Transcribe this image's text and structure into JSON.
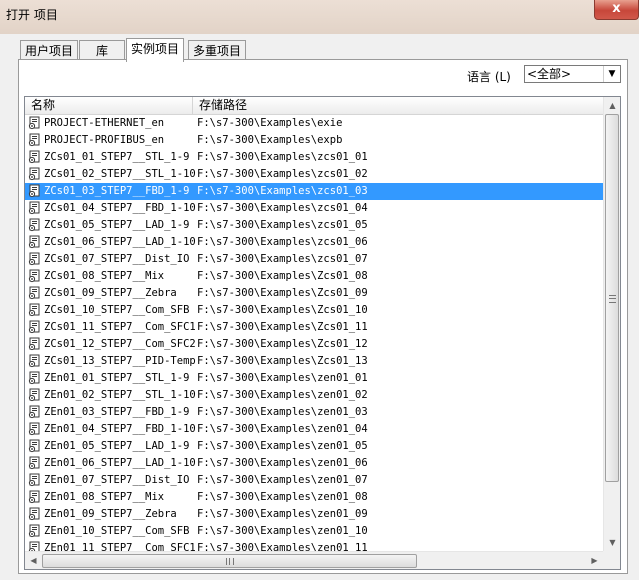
{
  "window": {
    "title": "打开 项目",
    "close_label": "x"
  },
  "tabs": [
    {
      "label": "用户项目"
    },
    {
      "label": "库"
    },
    {
      "label": "实例项目"
    },
    {
      "label": "多重项目"
    }
  ],
  "language": {
    "label": "语言 (L)",
    "selected": "<全部>"
  },
  "columns": {
    "name": "名称",
    "path": "存储路径"
  },
  "projects": [
    {
      "name": "PROJECT-ETHERNET_en",
      "path": "F:\\s7-300\\Examples\\exie"
    },
    {
      "name": "PROJECT-PROFIBUS_en",
      "path": "F:\\s7-300\\Examples\\expb"
    },
    {
      "name": "ZCs01_01_STEP7__STL_1-9",
      "path": "F:\\s7-300\\Examples\\zcs01_01"
    },
    {
      "name": "ZCs01_02_STEP7__STL_1-10",
      "path": "F:\\s7-300\\Examples\\zcs01_02"
    },
    {
      "name": "ZCs01_03_STEP7__FBD_1-9",
      "path": "F:\\s7-300\\Examples\\zcs01_03"
    },
    {
      "name": "ZCs01_04_STEP7__FBD_1-10",
      "path": "F:\\s7-300\\Examples\\zcs01_04"
    },
    {
      "name": "ZCs01_05_STEP7__LAD_1-9",
      "path": "F:\\s7-300\\Examples\\zcs01_05"
    },
    {
      "name": "ZCs01_06_STEP7__LAD_1-10",
      "path": "F:\\s7-300\\Examples\\zcs01_06"
    },
    {
      "name": "ZCs01_07_STEP7__Dist_IO",
      "path": "F:\\s7-300\\Examples\\zcs01_07"
    },
    {
      "name": "ZCs01_08_STEP7__Mix",
      "path": "F:\\s7-300\\Examples\\Zcs01_08"
    },
    {
      "name": "ZCs01_09_STEP7__Zebra",
      "path": "F:\\s7-300\\Examples\\Zcs01_09"
    },
    {
      "name": "ZCs01_10_STEP7__Com_SFB",
      "path": "F:\\s7-300\\Examples\\Zcs01_10"
    },
    {
      "name": "ZCs01_11_STEP7__Com_SFC1",
      "path": "F:\\s7-300\\Examples\\Zcs01_11"
    },
    {
      "name": "ZCs01_12_STEP7__Com_SFC2",
      "path": "F:\\s7-300\\Examples\\Zcs01_12"
    },
    {
      "name": "ZCs01_13_STEP7__PID-Temp",
      "path": "F:\\s7-300\\Examples\\Zcs01_13"
    },
    {
      "name": "ZEn01_01_STEP7__STL_1-9",
      "path": "F:\\s7-300\\Examples\\zen01_01"
    },
    {
      "name": "ZEn01_02_STEP7__STL_1-10",
      "path": "F:\\s7-300\\Examples\\zen01_02"
    },
    {
      "name": "ZEn01_03_STEP7__FBD_1-9",
      "path": "F:\\s7-300\\Examples\\zen01_03"
    },
    {
      "name": "ZEn01_04_STEP7__FBD_1-10",
      "path": "F:\\s7-300\\Examples\\zen01_04"
    },
    {
      "name": "ZEn01_05_STEP7__LAD_1-9",
      "path": "F:\\s7-300\\Examples\\zen01_05"
    },
    {
      "name": "ZEn01_06_STEP7__LAD_1-10",
      "path": "F:\\s7-300\\Examples\\zen01_06"
    },
    {
      "name": "ZEn01_07_STEP7__Dist_IO",
      "path": "F:\\s7-300\\Examples\\zen01_07"
    },
    {
      "name": "ZEn01_08_STEP7__Mix",
      "path": "F:\\s7-300\\Examples\\zen01_08"
    },
    {
      "name": "ZEn01_09_STEP7__Zebra",
      "path": "F:\\s7-300\\Examples\\zen01_09"
    },
    {
      "name": "ZEn01_10_STEP7__Com_SFB",
      "path": "F:\\s7-300\\Examples\\zen01_10"
    },
    {
      "name": "ZEn01_11_STEP7__Com_SFC1",
      "path": "F:\\s7-300\\Examples\\zen01_11"
    }
  ],
  "selected_index": 4,
  "icon": "project-icon",
  "colors": {
    "selection": "#3399ff",
    "close_button": "#c7473a"
  }
}
